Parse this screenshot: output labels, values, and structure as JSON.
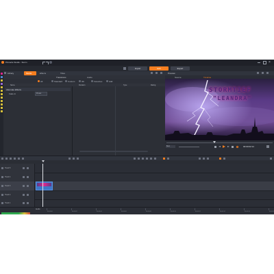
{
  "window": {
    "title": "Pinnacle Studio - Storm",
    "tabs": [
      {
        "label": "Import",
        "active": false
      },
      {
        "label": "Edit",
        "active": true
      },
      {
        "label": "Export",
        "active": false
      }
    ]
  },
  "library": {
    "header_title": "Library",
    "tabs": [
      "Media",
      "Effects",
      "Titles",
      "Audio"
    ],
    "category_label": "Transitions",
    "options": [
      "All",
      "Standard",
      "Custom",
      "3D",
      "Favorites",
      "Add"
    ],
    "columns": [
      "Name",
      "Duration",
      "Type",
      "Rating"
    ],
    "items": [
      {
        "label": "Alternate Effects"
      },
      {
        "label": "Fade In",
        "value": "Preset"
      }
    ]
  },
  "preview": {
    "header_title": "Preview",
    "tabs": [
      "Source",
      "Timeline"
    ],
    "title_line1": "STORMTIEF",
    "title_line2": "\"LEANDRA\"",
    "quality": "Best",
    "timecode": "00:00:02:14"
  },
  "timeline": {
    "ruler_labels": [
      "00:00:00",
      "00:00:02",
      "00:00:04",
      "00:00:06",
      "00:00:08",
      "00:00:10",
      "00:00:12",
      "00:00:14",
      "00:00:16",
      "00:00:18"
    ],
    "tracks": [
      {
        "name": "Track 5"
      },
      {
        "name": "Track 4"
      },
      {
        "name": "Track 3"
      },
      {
        "name": "Track 2"
      },
      {
        "name": "Track 1"
      }
    ],
    "footer_label": "Audio"
  },
  "colors": {
    "accent": "#f57e20",
    "clip_blue": "#3e77c8",
    "clip_pink": "#e0288e",
    "storm_purple": "#5a3a86"
  }
}
